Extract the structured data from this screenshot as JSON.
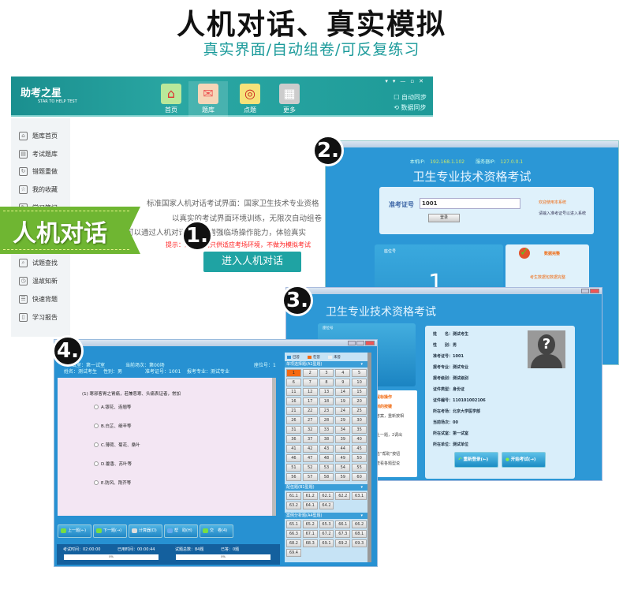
{
  "title": "人机对话、真实模拟",
  "subtitle": "真实界面/自动组卷/可反复练习",
  "badge": "人机对话",
  "step_numbers": [
    "1.",
    "2.",
    "3.",
    "4."
  ],
  "app": {
    "logo": "助考之星",
    "logo_sub": "STAR TO HELP TEST",
    "nav": [
      {
        "label": "首页",
        "icon": "home-icon"
      },
      {
        "label": "题库",
        "icon": "envelope-icon"
      },
      {
        "label": "点题",
        "icon": "target-icon"
      },
      {
        "label": "更多",
        "icon": "grid-icon"
      }
    ],
    "auto_sync": "自动同步",
    "data_sync": "数据同步",
    "sidebar": [
      "题库首页",
      "考试题库",
      "错题重做",
      "我的收藏",
      "学习笔记",
      "试题查找",
      "温故知新",
      "快速背题",
      "学习报告"
    ],
    "desc_lines": [
      "标准国家人机对话考试界面：国家卫生技术专业资格",
      "以真实的考试界面环境训练，无限次自动组卷",
      "可以通过人机对话练习，增强临场操作能力，体验真实"
    ],
    "warning": "提示：人机对话只供适应考场环境，不做为模拟考试",
    "enter_button": "进入人机对话"
  },
  "login": {
    "local_ip_label": "本机IP:",
    "local_ip": "192.168.1.102",
    "server_ip_label": "服务器IP:",
    "server_ip": "127.0.0.1",
    "title": "卫生专业技术资格考试",
    "id_label": "准考证号",
    "id_value": "1001",
    "login_button": "登录",
    "welcome": "欢迎使用本系统",
    "hint": "请输入准考证号以进入系统",
    "seat_label": "座位号",
    "seat_value": "1",
    "status_title": "数据完整",
    "status_text": "考生数据包数据完整"
  },
  "confirm": {
    "title": "卫生专业技术资格考试",
    "seat_label": "座位号",
    "tips": [
      "鼠标操作",
      "到的按键",
      "答案，重新按相",
      "。",
      "上一题，2调出",
      "。",
      "击“帮助”按钮",
      "查看各题型说"
    ],
    "fields": [
      [
        "姓　　名：",
        "测试考生"
      ],
      [
        "性　　别：",
        "男"
      ],
      [
        "准考证号：",
        "1001"
      ],
      [
        "报考专业：",
        "测试专业"
      ],
      [
        "报考级别：",
        "测试级别"
      ],
      [
        "证件类型：",
        "身份证"
      ],
      [
        "证件编号：",
        "110101002106"
      ],
      [
        "所在考场：",
        "北京大学医学部"
      ],
      [
        "当前场次：",
        "00"
      ],
      [
        "所在试室：",
        "第一试室"
      ],
      [
        "所在单位：",
        "测试单位"
      ]
    ],
    "relogin": "重新登录(←)",
    "start": "开始考试(→)"
  },
  "exam": {
    "room": "试室：第一试室",
    "session": "当前场次：第00场",
    "seat": "座位号：1",
    "name": "姓名：测试考生",
    "gender": "性别：男",
    "id": "准考证号：1001",
    "major": "报考专业：测试专业",
    "question": "(1) 寒邪客胃之胃痛，若兼恶寒、头痛表证者，常加",
    "options": [
      "A.银花、连翘等",
      "B.白芷、细辛等",
      "C.薄荷、菊花、桑叶",
      "D.藿香、苏叶等",
      "E.防风、荆芥等"
    ],
    "legend": [
      "已答",
      "在答",
      "未答"
    ],
    "legend_colors": [
      "#2a8fd6",
      "#f56a12",
      "#eeeeee"
    ],
    "sections": [
      {
        "name": "单项选择题(A1型题)",
        "items": [
          "1",
          "2",
          "3",
          "4",
          "5",
          "6",
          "7",
          "8",
          "9",
          "10",
          "11",
          "12",
          "13",
          "14",
          "15",
          "16",
          "17",
          "18",
          "19",
          "20",
          "21",
          "22",
          "23",
          "24",
          "25",
          "26",
          "27",
          "28",
          "29",
          "30",
          "31",
          "32",
          "33",
          "34",
          "35",
          "36",
          "37",
          "38",
          "39",
          "40",
          "41",
          "42",
          "43",
          "44",
          "45",
          "46",
          "47",
          "48",
          "49",
          "50",
          "51",
          "52",
          "53",
          "54",
          "55",
          "56",
          "57",
          "58",
          "59",
          "60"
        ]
      },
      {
        "name": "配伍题(B1型题)",
        "items": [
          "61.1",
          "61.2",
          "62.1",
          "62.2",
          "63.1",
          "63.2",
          "64.1",
          "64.2"
        ]
      },
      {
        "name": "案例分析题(A4型题)",
        "items": [
          "65.1",
          "65.2",
          "65.3",
          "66.1",
          "66.2",
          "66.3",
          "67.1",
          "67.2",
          "67.3",
          "68.1",
          "68.2",
          "68.3",
          "69.1",
          "69.2",
          "69.3",
          "69.4"
        ]
      }
    ],
    "current": "1",
    "buttons": [
      "上一题(←)",
      "下一题(→)",
      "计算器(D)",
      "帮　助(H)",
      "交　卷(4)"
    ],
    "exam_time": "考试时间：02:00:00",
    "used_time": "已用时间：00:00:44",
    "total": "试题总数：84题",
    "answered": "已答：0题",
    "progress_time": "0%",
    "progress_answered": "0%"
  }
}
